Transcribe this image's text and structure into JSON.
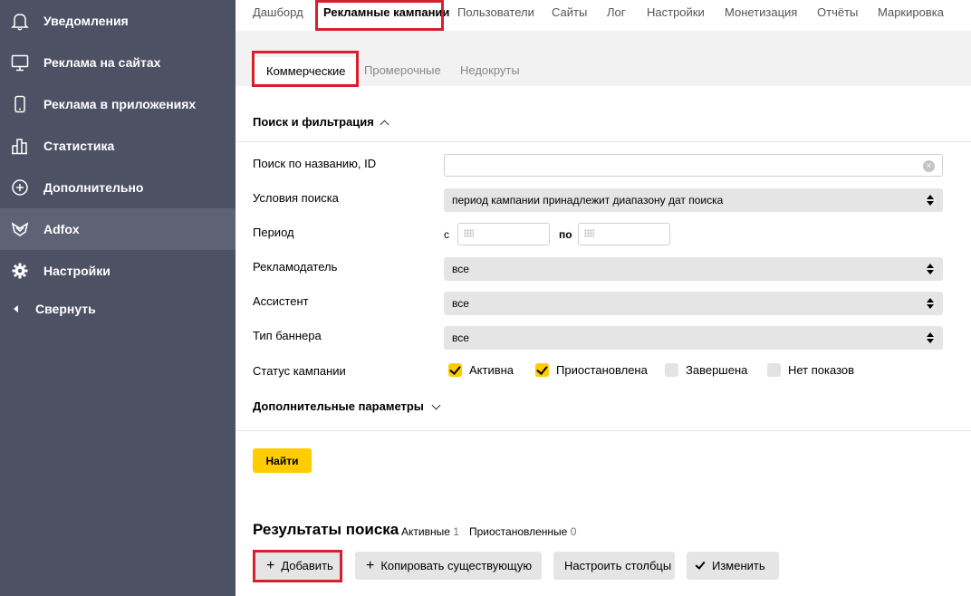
{
  "sidebar": {
    "items": [
      {
        "label": "Уведомления",
        "icon": "bell-icon"
      },
      {
        "label": "Реклама на сайтах",
        "icon": "monitor-icon"
      },
      {
        "label": "Реклама в приложениях",
        "icon": "phone-icon"
      },
      {
        "label": "Статистика",
        "icon": "stats-icon"
      },
      {
        "label": "Дополнительно",
        "icon": "plus-circle-icon"
      },
      {
        "label": "Adfox",
        "icon": "adfox-icon",
        "active": true
      },
      {
        "label": "Настройки",
        "icon": "gear-icon"
      }
    ],
    "collapse_label": "Свернуть"
  },
  "topnav": {
    "tabs": [
      "Дашборд",
      "Рекламные кампании",
      "Пользователи",
      "Сайты",
      "Лог",
      "Настройки",
      "Монетизация",
      "Отчёты",
      "Маркировка"
    ],
    "active": "Рекламные кампании"
  },
  "subtabs": {
    "items": [
      "Коммерческие",
      "Промерочные",
      "Недокруты"
    ],
    "active": "Коммерческие"
  },
  "filters": {
    "title": "Поиск и фильтрация",
    "search_label": "Поиск по названию, ID",
    "search_value": "",
    "conditions_label": "Условия поиска",
    "conditions_value": "период кампании принадлежит диапазону дат поиска",
    "period_label": "Период",
    "period_from": "с",
    "period_to": "по",
    "advertiser_label": "Рекламодатель",
    "advertiser_value": "все",
    "assistant_label": "Ассистент",
    "assistant_value": "все",
    "banner_type_label": "Тип баннера",
    "banner_type_value": "все",
    "status_label": "Статус кампании",
    "statuses": [
      {
        "label": "Активна",
        "checked": true
      },
      {
        "label": "Приостановлена",
        "checked": true
      },
      {
        "label": "Завершена",
        "checked": false
      },
      {
        "label": "Нет показов",
        "checked": false
      }
    ],
    "more_params": "Дополнительные параметры",
    "find_button": "Найти"
  },
  "results": {
    "title": "Результаты поиска",
    "active_label": "Активные",
    "active_count": "1",
    "paused_label": "Приостановленные",
    "paused_count": "0",
    "buttons": {
      "add": "Добавить",
      "copy": "Копировать существующую",
      "columns": "Настроить столбцы",
      "edit": "Изменить"
    }
  },
  "colors": {
    "sidebar_bg": "#4c5164",
    "accent_yellow": "#ffcc00",
    "highlight_red": "#d6202d"
  }
}
